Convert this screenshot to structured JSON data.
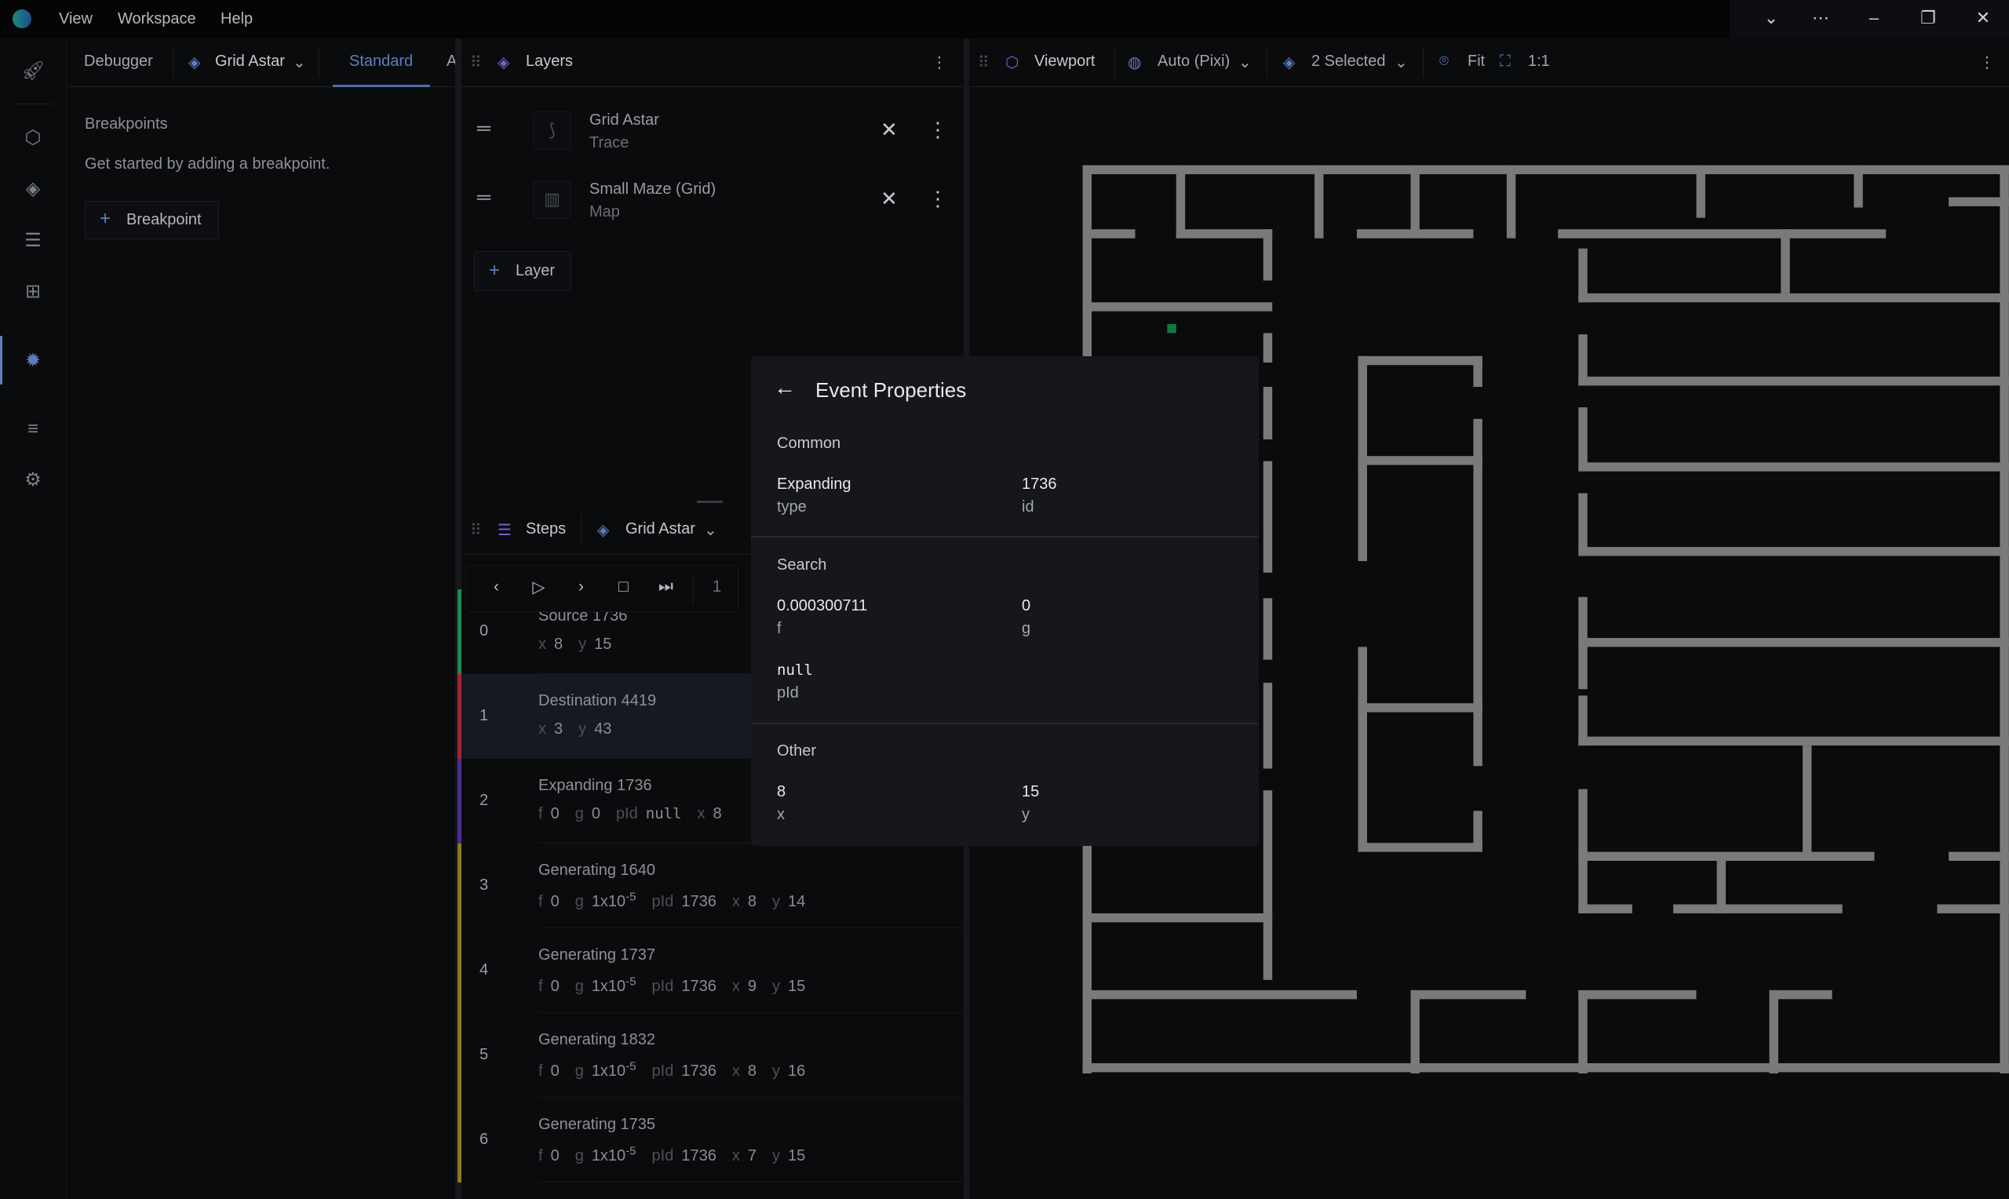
{
  "menubar": {
    "items": [
      "View",
      "Workspace",
      "Help"
    ]
  },
  "debugger": {
    "tab": "Debugger",
    "source": "Grid Astar",
    "mode": "Standard",
    "mode_next": "A",
    "section_title": "Breakpoints",
    "empty_text": "Get started by adding a breakpoint.",
    "add_label": "Breakpoint"
  },
  "layers": {
    "title": "Layers",
    "items": [
      {
        "name": "Grid Astar",
        "type": "Trace"
      },
      {
        "name": "Small Maze (Grid)",
        "type": "Map"
      }
    ],
    "add_label": "Layer"
  },
  "viewport": {
    "title": "Viewport",
    "renderer": "Auto (Pixi)",
    "selection": "2 Selected",
    "fit_label": "Fit",
    "scale_label": "1:1"
  },
  "steps": {
    "title": "Steps",
    "source": "Grid Astar",
    "current_step": "1",
    "colors": {
      "source": "#1f8a4c",
      "destination": "#a3243a",
      "expanding": "#4b2e8f",
      "generating": "#8a7a1e"
    },
    "rows": [
      {
        "index": "0",
        "title": "Source 1736",
        "kind": "source",
        "props": [
          {
            "k": "x",
            "v": "8"
          },
          {
            "k": "y",
            "v": "15"
          }
        ]
      },
      {
        "index": "1",
        "title": "Destination 4419",
        "kind": "destination",
        "props": [
          {
            "k": "x",
            "v": "3"
          },
          {
            "k": "y",
            "v": "43"
          }
        ]
      },
      {
        "index": "2",
        "title": "Expanding 1736",
        "kind": "expanding",
        "props": [
          {
            "k": "f",
            "v": "0"
          },
          {
            "k": "g",
            "v": "0"
          },
          {
            "k": "pId",
            "v": "null",
            "mono": true
          },
          {
            "k": "x",
            "v": "8"
          }
        ]
      },
      {
        "index": "3",
        "title": "Generating 1640",
        "kind": "generating",
        "props": [
          {
            "k": "f",
            "v": "0"
          },
          {
            "k": "g",
            "v": "1x10",
            "sup": "-5"
          },
          {
            "k": "pId",
            "v": "1736"
          },
          {
            "k": "x",
            "v": "8"
          },
          {
            "k": "y",
            "v": "14"
          }
        ]
      },
      {
        "index": "4",
        "title": "Generating 1737",
        "kind": "generating",
        "props": [
          {
            "k": "f",
            "v": "0"
          },
          {
            "k": "g",
            "v": "1x10",
            "sup": "-5"
          },
          {
            "k": "pId",
            "v": "1736"
          },
          {
            "k": "x",
            "v": "9"
          },
          {
            "k": "y",
            "v": "15"
          }
        ]
      },
      {
        "index": "5",
        "title": "Generating 1832",
        "kind": "generating",
        "props": [
          {
            "k": "f",
            "v": "0"
          },
          {
            "k": "g",
            "v": "1x10",
            "sup": "-5"
          },
          {
            "k": "pId",
            "v": "1736"
          },
          {
            "k": "x",
            "v": "8"
          },
          {
            "k": "y",
            "v": "16"
          }
        ]
      },
      {
        "index": "6",
        "title": "Generating 1735",
        "kind": "generating",
        "props": [
          {
            "k": "f",
            "v": "0"
          },
          {
            "k": "g",
            "v": "1x10",
            "sup": "-5"
          },
          {
            "k": "pId",
            "v": "1736"
          },
          {
            "k": "x",
            "v": "7"
          },
          {
            "k": "y",
            "v": "15"
          }
        ]
      }
    ]
  },
  "event_properties": {
    "title": "Event Properties",
    "sections": [
      {
        "name": "Common",
        "fields": [
          {
            "value": "Expanding",
            "key": "type"
          },
          {
            "value": "1736",
            "key": "id"
          }
        ]
      },
      {
        "name": "Search",
        "fields": [
          {
            "value": "0.000300711",
            "key": "f"
          },
          {
            "value": "0",
            "key": "g"
          },
          {
            "value": "null",
            "key": "pId"
          }
        ]
      },
      {
        "name": "Other",
        "fields": [
          {
            "value": "8",
            "key": "x"
          },
          {
            "value": "15",
            "key": "y"
          }
        ]
      }
    ]
  },
  "map": {
    "wall_color": "#7a7a7a",
    "node_color": "#0f7a3e"
  }
}
